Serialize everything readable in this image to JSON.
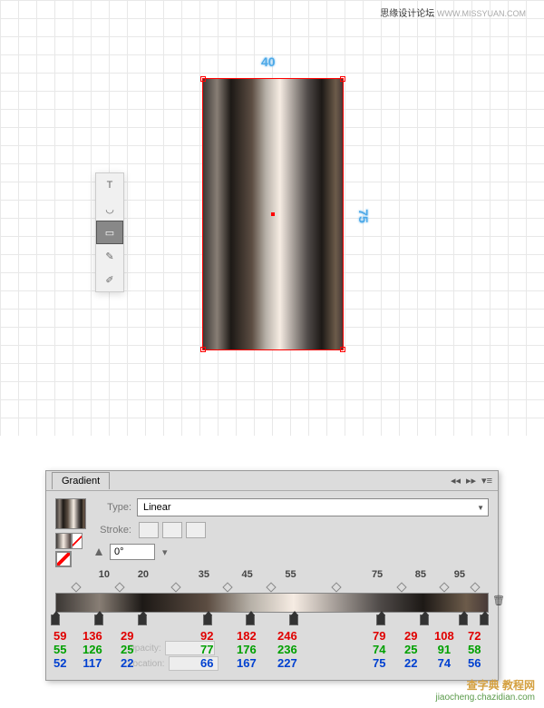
{
  "header": {
    "site": "思缘设计论坛",
    "url": "WWW.MISSYUAN.COM"
  },
  "canvas": {
    "width_label": "40",
    "height_label": "75"
  },
  "panel": {
    "title": "Gradient",
    "type_label": "Type:",
    "type_value": "Linear",
    "stroke_label": "Stroke:",
    "angle_value": "0°",
    "opacity_label": "Opacity:",
    "location_label": "Location:"
  },
  "chart_data": {
    "type": "table",
    "title": "Gradient Stops (RGB)",
    "top_labels": [
      "10",
      "20",
      "35",
      "45",
      "55",
      "75",
      "85",
      "95"
    ],
    "stop_positions": [
      0,
      10,
      20,
      35,
      45,
      55,
      75,
      85,
      95,
      100
    ],
    "rgb": [
      {
        "r": 59,
        "g": 55,
        "b": 52
      },
      {
        "r": 136,
        "g": 126,
        "b": 117
      },
      {
        "r": 29,
        "g": 25,
        "b": 22
      },
      {
        "r": 92,
        "g": 77,
        "b": 66
      },
      {
        "r": 182,
        "g": 176,
        "b": 167
      },
      {
        "r": 246,
        "g": 236,
        "b": 227
      },
      {
        "r": 79,
        "g": 74,
        "b": 75
      },
      {
        "r": 29,
        "g": 25,
        "b": 22
      },
      {
        "r": 108,
        "g": 91,
        "b": 74
      },
      {
        "r": 72,
        "g": 58,
        "b": 56
      }
    ]
  },
  "watermark": {
    "line1": "查字典 教程网",
    "line2": "jiaocheng.chazidian.com"
  }
}
